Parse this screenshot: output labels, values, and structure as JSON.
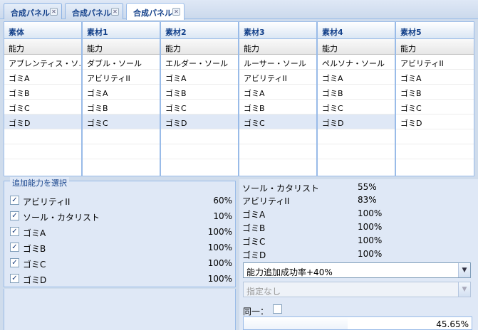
{
  "tabs": [
    {
      "label": "合成パネル",
      "close": "✕"
    },
    {
      "label": "合成パネル",
      "close": "✕"
    },
    {
      "label": "合成パネル",
      "close": "✕"
    }
  ],
  "grid": {
    "sub_header": "能力",
    "columns": [
      {
        "header": "素体",
        "cells": [
          "アブレンティス・ソ…",
          "ゴミA",
          "ゴミB",
          "ゴミC",
          "ゴミD"
        ]
      },
      {
        "header": "素材1",
        "cells": [
          "ダブル・ソール",
          "アビリティII",
          "ゴミA",
          "ゴミB",
          "ゴミC"
        ]
      },
      {
        "header": "素材2",
        "cells": [
          "エルダー・ソール",
          "ゴミA",
          "ゴミB",
          "ゴミC",
          "ゴミD"
        ]
      },
      {
        "header": "素材3",
        "cells": [
          "ルーサー・ソール",
          "アビリティII",
          "ゴミA",
          "ゴミB",
          "ゴミC"
        ]
      },
      {
        "header": "素材4",
        "cells": [
          "ペルソナ・ソール",
          "ゴミA",
          "ゴミB",
          "ゴミC",
          "ゴミD"
        ]
      },
      {
        "header": "素材5",
        "cells": [
          "アビリティII",
          "ゴミA",
          "ゴミB",
          "ゴミC",
          "ゴミD"
        ]
      }
    ]
  },
  "selection": {
    "legend": "追加能力を選択",
    "items": [
      {
        "label": "アビリティII",
        "pct": "60%",
        "checked": true,
        "mark": "✓"
      },
      {
        "label": "ソール・カタリスト",
        "pct": "10%",
        "checked": true,
        "mark": "✓"
      },
      {
        "label": "ゴミA",
        "pct": "100%",
        "checked": true,
        "mark": "✓"
      },
      {
        "label": "ゴミB",
        "pct": "100%",
        "checked": true,
        "mark": "✓"
      },
      {
        "label": "ゴミC",
        "pct": "100%",
        "checked": true,
        "mark": "✓"
      },
      {
        "label": "ゴミD",
        "pct": "100%",
        "checked": true,
        "mark": "✓"
      }
    ]
  },
  "stats": [
    {
      "name": "ソール・カタリスト",
      "pct": "55%"
    },
    {
      "name": "アビリティII",
      "pct": "83%"
    },
    {
      "name": "ゴミA",
      "pct": "100%"
    },
    {
      "name": "ゴミB",
      "pct": "100%"
    },
    {
      "name": "ゴミC",
      "pct": "100%"
    },
    {
      "name": "ゴミD",
      "pct": "100%"
    }
  ],
  "boost_combo": {
    "value": "能力追加成功率+40%",
    "trigger": "▼"
  },
  "spec_combo": {
    "value": "指定なし",
    "trigger": "▼"
  },
  "same": {
    "label": "同一：",
    "checked": false
  },
  "progress": {
    "value": 45.65,
    "label": "45.65%"
  },
  "colors": {
    "accent": "#15428b",
    "border": "#99bbe8",
    "panel": "#dfe8f6",
    "selected_row": "#dfe8f6"
  }
}
